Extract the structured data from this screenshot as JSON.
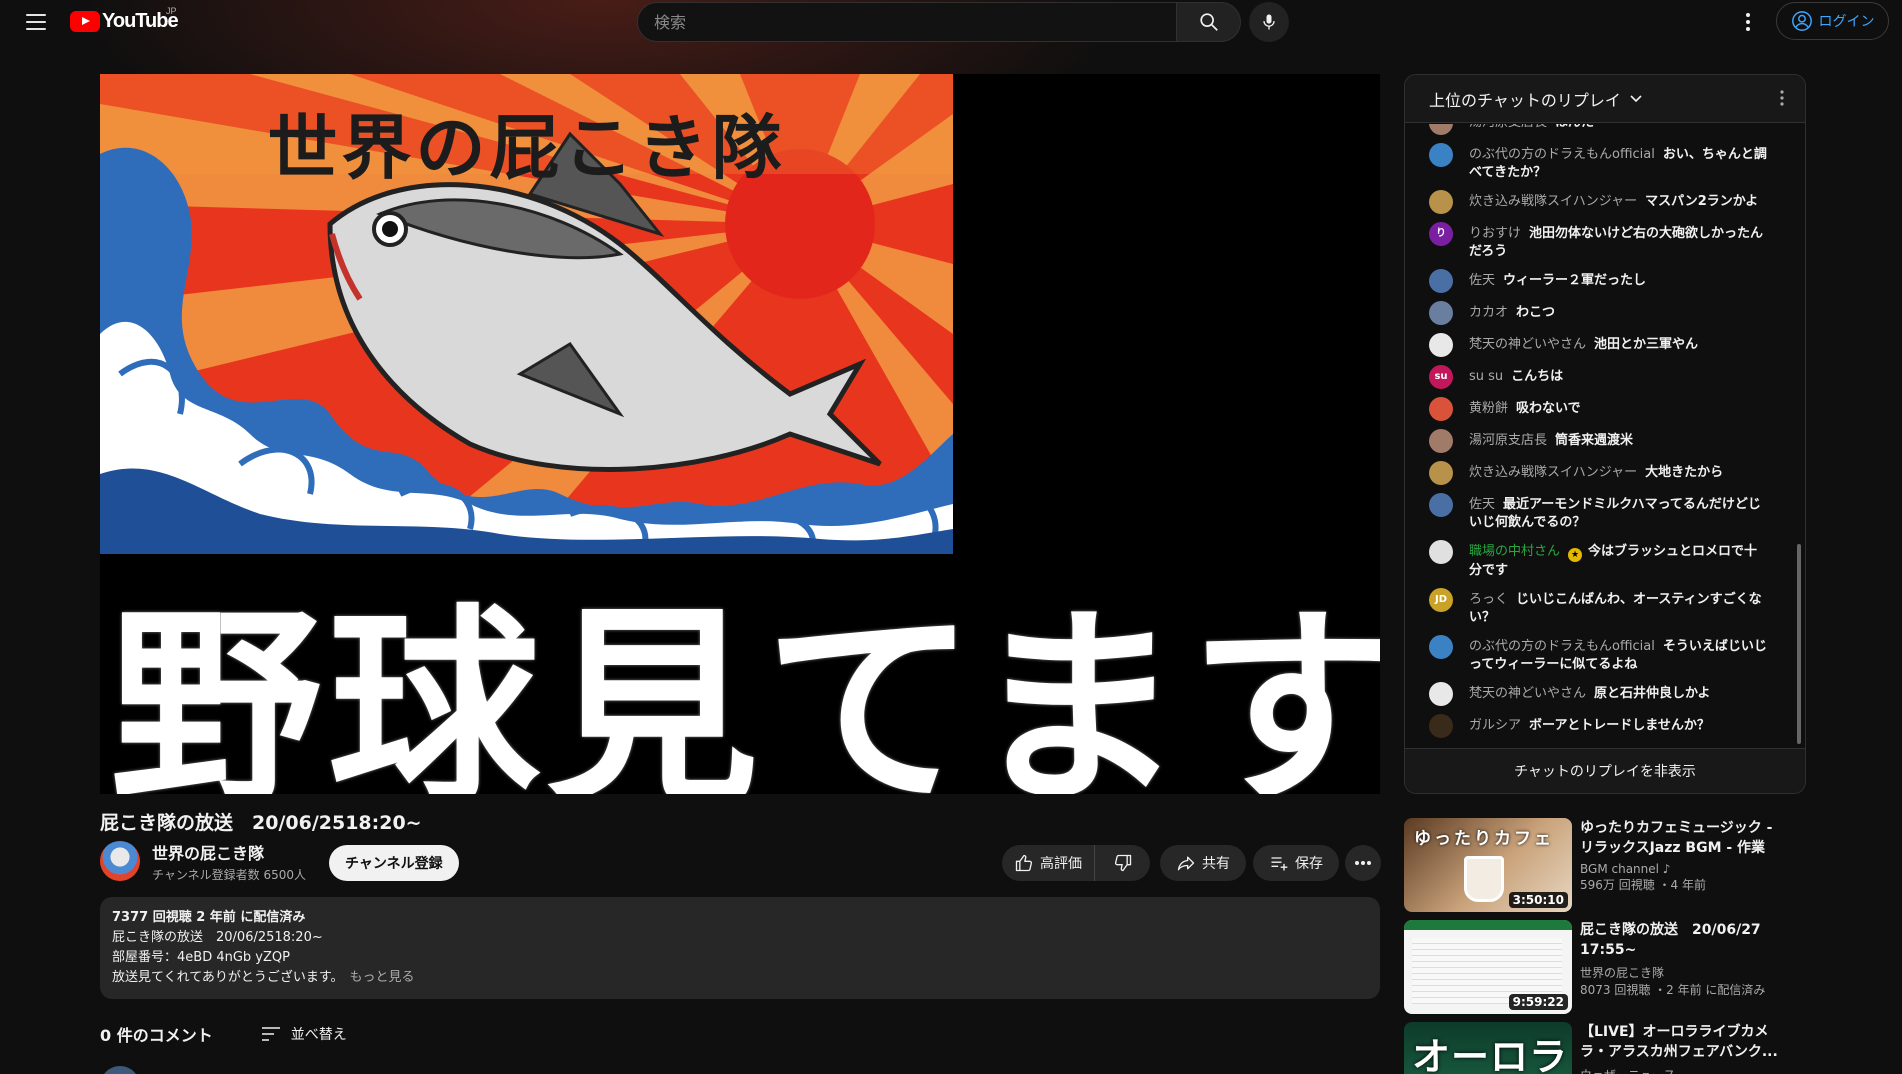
{
  "masthead": {
    "logo_text": "YouTube",
    "logo_region": "JP",
    "search_placeholder": "検索",
    "login_label": "ログイン"
  },
  "player": {
    "thumb_title": "世界の屁こき隊",
    "overlay_text": "野球見てます"
  },
  "video": {
    "title": "屁こき隊の放送　20/06/2518:20~",
    "channel_name": "世界の屁こき隊",
    "subscribers": "チャンネル登録者数 6500人",
    "subscribe_label": "チャンネル登録",
    "like_label": "高評価",
    "share_label": "共有",
    "save_label": "保存"
  },
  "description": {
    "stats": "7377 回視聴  2 年前 に配信済み",
    "line1": "屁こき隊の放送　20/06/2518:20~",
    "line2": "部屋番号：4eBD 4nGb yZQP",
    "line3": "放送見てくれてありがとうございます。",
    "more_label": "もっと見る"
  },
  "comments": {
    "count_label": "0 件のコメント",
    "sort_label": "並べ替え"
  },
  "chat": {
    "header": "上位のチャットのリプレイ",
    "footer": "チャットのリプレイを非表示",
    "messages": [
      {
        "author": "湯河原支店長",
        "text": "ほんた",
        "color": "#a07b6a",
        "initial": ""
      },
      {
        "author": "のぶ代の方のドラえもんofficial",
        "text": "おい、ちゃんと調べてきたか？",
        "color": "#3b82c4",
        "initial": ""
      },
      {
        "author": "炊き込み戦隊スイハンジャー",
        "text": "マスパン2ランかよ",
        "color": "#b8924a",
        "initial": ""
      },
      {
        "author": "りおすけ",
        "text": "池田勿体ないけど右の大砲欲しかったんだろう",
        "color": "#7b1fa2",
        "initial": "り"
      },
      {
        "author": "佐天",
        "text": "ウィーラー２軍だったし",
        "color": "#4a6fa5",
        "initial": ""
      },
      {
        "author": "カカオ",
        "text": "わこつ",
        "color": "#6a7fa0",
        "initial": ""
      },
      {
        "author": "梵天の神どいやさん",
        "text": "池田とか三軍やん",
        "color": "#e8e8e8",
        "initial": ""
      },
      {
        "author": "su su",
        "text": "こんちは",
        "color": "#c2185b",
        "initial": "su"
      },
      {
        "author": "黄粉餅",
        "text": "吸わないで",
        "color": "#d9533a",
        "initial": ""
      },
      {
        "author": "湯河原支店長",
        "text": "筒香来週渡米",
        "color": "#a07b6a",
        "initial": ""
      },
      {
        "author": "炊き込み戦隊スイハンジャー",
        "text": "大地きたから",
        "color": "#b8924a",
        "initial": ""
      },
      {
        "author": "佐天",
        "text": "最近アーモンドミルクハマってるんだけどじいじ何飲んでるの？",
        "color": "#4a6fa5",
        "initial": ""
      },
      {
        "author": "職場の中村さん",
        "text": "今はブラッシュとロメロで十分です",
        "color": "#e0e0e0",
        "initial": "",
        "green": true
      },
      {
        "author": "ろっく",
        "text": "じいじこんばんわ、オースティンすごくない？",
        "color": "#c9a227",
        "initial": "JD"
      },
      {
        "author": "のぶ代の方のドラえもんofficial",
        "text": "そういえばじいじってウィーラーに似てるよね",
        "color": "#3b82c4",
        "initial": ""
      },
      {
        "author": "梵天の神どいやさん",
        "text": "原と石井仲良しかよ",
        "color": "#e8e8e8",
        "initial": ""
      },
      {
        "author": "ガルシア",
        "text": "ボーアとトレードしませんか？",
        "color": "#3a2a1a",
        "initial": ""
      }
    ]
  },
  "recommendations": [
    {
      "title": "ゆったりカフェミュージック - リラックスJazz BGM - 作業用...",
      "channel": "BGM channel ♪",
      "stats": "596万 回視聴 ・4 年前",
      "duration": "3:50:10",
      "thumb_text": "ゆったりカフェ"
    },
    {
      "title": "屁こき隊の放送　20/06/27 17:55~",
      "channel": "世界の屁こき隊",
      "stats": "8073 回視聴 ・2 年前 に配信済み",
      "duration": "9:59:22",
      "thumb_text": ""
    },
    {
      "title": "【LIVE】オーロラライブカメラ・アラスカ州フェアバンク...",
      "channel": "ウェザーニュース",
      "stats": "",
      "duration": "",
      "thumb_text": "オーロラ"
    }
  ],
  "colors": {
    "accent_red": "#ff0000",
    "link_blue": "#3ea6ff",
    "chat_green": "#2ba640"
  }
}
